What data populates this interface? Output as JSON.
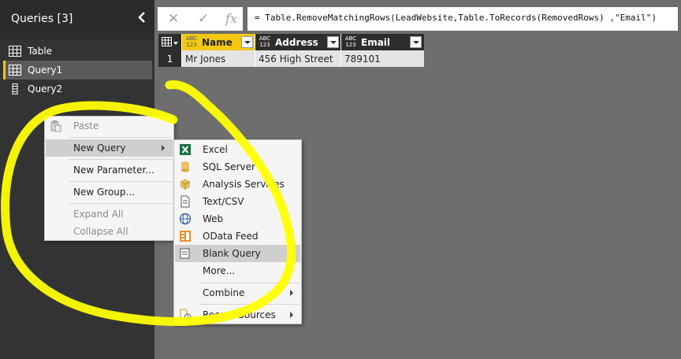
{
  "sidebar": {
    "title": "Queries [3]",
    "items": [
      {
        "label": "Table"
      },
      {
        "label": "Query1"
      },
      {
        "label": "Query2"
      }
    ]
  },
  "formula_bar": {
    "cancel_icon": "x-icon",
    "confirm_icon": "check-icon",
    "fx_label": "fx",
    "formula": "= Table.RemoveMatchingRows(LeadWebsite,Table.ToRecords(RemovedRows)  ,\"Email\")"
  },
  "grid": {
    "columns": [
      {
        "type": "ABC\n123",
        "label": "Name"
      },
      {
        "type": "ABC\n123",
        "label": "Address"
      },
      {
        "type": "ABC\n123",
        "label": "Email"
      }
    ],
    "rows": [
      {
        "num": "1",
        "cells": [
          "Mr Jones",
          "456 High Street",
          "789101"
        ]
      }
    ]
  },
  "context_menu": {
    "items": [
      {
        "label": "Paste",
        "disabled": true
      },
      {
        "label": "New Query",
        "submenu": true
      },
      {
        "label": "New Parameter..."
      },
      {
        "label": "New Group..."
      },
      {
        "label": "Expand All",
        "disabled": true
      },
      {
        "label": "Collapse All",
        "disabled": true
      }
    ]
  },
  "submenu": {
    "items": [
      {
        "label": "Excel",
        "icon": "excel-icon"
      },
      {
        "label": "SQL Server",
        "icon": "database-icon"
      },
      {
        "label": "Analysis Services",
        "icon": "cube-icon"
      },
      {
        "label": "Text/CSV",
        "icon": "document-icon"
      },
      {
        "label": "Web",
        "icon": "globe-icon"
      },
      {
        "label": "OData Feed",
        "icon": "odata-icon"
      },
      {
        "label": "Blank Query",
        "icon": "blank-query-icon"
      },
      {
        "label": "More..."
      },
      {
        "label": "Combine"
      },
      {
        "label": "Recent Sources",
        "icon": "recent-sources-icon"
      }
    ]
  },
  "colors": {
    "accent": "#f2c811",
    "sidebar_bg": "#333333",
    "main_bg": "#6e6e6e",
    "highlight": "#ffff00"
  }
}
